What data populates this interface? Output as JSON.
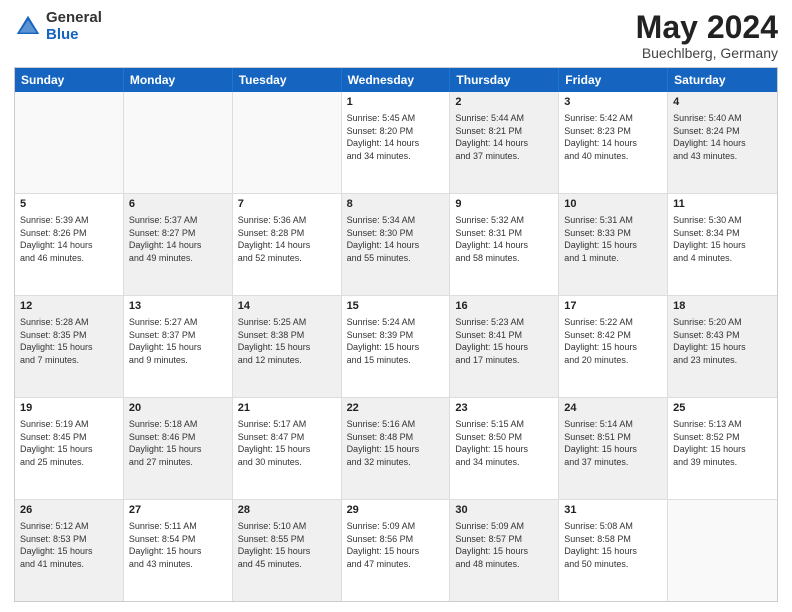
{
  "header": {
    "logo_general": "General",
    "logo_blue": "Blue",
    "title": "May 2024",
    "location": "Buechlberg, Germany"
  },
  "weekdays": [
    "Sunday",
    "Monday",
    "Tuesday",
    "Wednesday",
    "Thursday",
    "Friday",
    "Saturday"
  ],
  "rows": [
    [
      {
        "day": "",
        "info": "",
        "shaded": false,
        "empty": true
      },
      {
        "day": "",
        "info": "",
        "shaded": false,
        "empty": true
      },
      {
        "day": "",
        "info": "",
        "shaded": false,
        "empty": true
      },
      {
        "day": "1",
        "info": "Sunrise: 5:45 AM\nSunset: 8:20 PM\nDaylight: 14 hours\nand 34 minutes.",
        "shaded": false,
        "empty": false
      },
      {
        "day": "2",
        "info": "Sunrise: 5:44 AM\nSunset: 8:21 PM\nDaylight: 14 hours\nand 37 minutes.",
        "shaded": true,
        "empty": false
      },
      {
        "day": "3",
        "info": "Sunrise: 5:42 AM\nSunset: 8:23 PM\nDaylight: 14 hours\nand 40 minutes.",
        "shaded": false,
        "empty": false
      },
      {
        "day": "4",
        "info": "Sunrise: 5:40 AM\nSunset: 8:24 PM\nDaylight: 14 hours\nand 43 minutes.",
        "shaded": true,
        "empty": false
      }
    ],
    [
      {
        "day": "5",
        "info": "Sunrise: 5:39 AM\nSunset: 8:26 PM\nDaylight: 14 hours\nand 46 minutes.",
        "shaded": false,
        "empty": false
      },
      {
        "day": "6",
        "info": "Sunrise: 5:37 AM\nSunset: 8:27 PM\nDaylight: 14 hours\nand 49 minutes.",
        "shaded": true,
        "empty": false
      },
      {
        "day": "7",
        "info": "Sunrise: 5:36 AM\nSunset: 8:28 PM\nDaylight: 14 hours\nand 52 minutes.",
        "shaded": false,
        "empty": false
      },
      {
        "day": "8",
        "info": "Sunrise: 5:34 AM\nSunset: 8:30 PM\nDaylight: 14 hours\nand 55 minutes.",
        "shaded": true,
        "empty": false
      },
      {
        "day": "9",
        "info": "Sunrise: 5:32 AM\nSunset: 8:31 PM\nDaylight: 14 hours\nand 58 minutes.",
        "shaded": false,
        "empty": false
      },
      {
        "day": "10",
        "info": "Sunrise: 5:31 AM\nSunset: 8:33 PM\nDaylight: 15 hours\nand 1 minute.",
        "shaded": true,
        "empty": false
      },
      {
        "day": "11",
        "info": "Sunrise: 5:30 AM\nSunset: 8:34 PM\nDaylight: 15 hours\nand 4 minutes.",
        "shaded": false,
        "empty": false
      }
    ],
    [
      {
        "day": "12",
        "info": "Sunrise: 5:28 AM\nSunset: 8:35 PM\nDaylight: 15 hours\nand 7 minutes.",
        "shaded": true,
        "empty": false
      },
      {
        "day": "13",
        "info": "Sunrise: 5:27 AM\nSunset: 8:37 PM\nDaylight: 15 hours\nand 9 minutes.",
        "shaded": false,
        "empty": false
      },
      {
        "day": "14",
        "info": "Sunrise: 5:25 AM\nSunset: 8:38 PM\nDaylight: 15 hours\nand 12 minutes.",
        "shaded": true,
        "empty": false
      },
      {
        "day": "15",
        "info": "Sunrise: 5:24 AM\nSunset: 8:39 PM\nDaylight: 15 hours\nand 15 minutes.",
        "shaded": false,
        "empty": false
      },
      {
        "day": "16",
        "info": "Sunrise: 5:23 AM\nSunset: 8:41 PM\nDaylight: 15 hours\nand 17 minutes.",
        "shaded": true,
        "empty": false
      },
      {
        "day": "17",
        "info": "Sunrise: 5:22 AM\nSunset: 8:42 PM\nDaylight: 15 hours\nand 20 minutes.",
        "shaded": false,
        "empty": false
      },
      {
        "day": "18",
        "info": "Sunrise: 5:20 AM\nSunset: 8:43 PM\nDaylight: 15 hours\nand 23 minutes.",
        "shaded": true,
        "empty": false
      }
    ],
    [
      {
        "day": "19",
        "info": "Sunrise: 5:19 AM\nSunset: 8:45 PM\nDaylight: 15 hours\nand 25 minutes.",
        "shaded": false,
        "empty": false
      },
      {
        "day": "20",
        "info": "Sunrise: 5:18 AM\nSunset: 8:46 PM\nDaylight: 15 hours\nand 27 minutes.",
        "shaded": true,
        "empty": false
      },
      {
        "day": "21",
        "info": "Sunrise: 5:17 AM\nSunset: 8:47 PM\nDaylight: 15 hours\nand 30 minutes.",
        "shaded": false,
        "empty": false
      },
      {
        "day": "22",
        "info": "Sunrise: 5:16 AM\nSunset: 8:48 PM\nDaylight: 15 hours\nand 32 minutes.",
        "shaded": true,
        "empty": false
      },
      {
        "day": "23",
        "info": "Sunrise: 5:15 AM\nSunset: 8:50 PM\nDaylight: 15 hours\nand 34 minutes.",
        "shaded": false,
        "empty": false
      },
      {
        "day": "24",
        "info": "Sunrise: 5:14 AM\nSunset: 8:51 PM\nDaylight: 15 hours\nand 37 minutes.",
        "shaded": true,
        "empty": false
      },
      {
        "day": "25",
        "info": "Sunrise: 5:13 AM\nSunset: 8:52 PM\nDaylight: 15 hours\nand 39 minutes.",
        "shaded": false,
        "empty": false
      }
    ],
    [
      {
        "day": "26",
        "info": "Sunrise: 5:12 AM\nSunset: 8:53 PM\nDaylight: 15 hours\nand 41 minutes.",
        "shaded": true,
        "empty": false
      },
      {
        "day": "27",
        "info": "Sunrise: 5:11 AM\nSunset: 8:54 PM\nDaylight: 15 hours\nand 43 minutes.",
        "shaded": false,
        "empty": false
      },
      {
        "day": "28",
        "info": "Sunrise: 5:10 AM\nSunset: 8:55 PM\nDaylight: 15 hours\nand 45 minutes.",
        "shaded": true,
        "empty": false
      },
      {
        "day": "29",
        "info": "Sunrise: 5:09 AM\nSunset: 8:56 PM\nDaylight: 15 hours\nand 47 minutes.",
        "shaded": false,
        "empty": false
      },
      {
        "day": "30",
        "info": "Sunrise: 5:09 AM\nSunset: 8:57 PM\nDaylight: 15 hours\nand 48 minutes.",
        "shaded": true,
        "empty": false
      },
      {
        "day": "31",
        "info": "Sunrise: 5:08 AM\nSunset: 8:58 PM\nDaylight: 15 hours\nand 50 minutes.",
        "shaded": false,
        "empty": false
      },
      {
        "day": "",
        "info": "",
        "shaded": true,
        "empty": true
      }
    ]
  ]
}
